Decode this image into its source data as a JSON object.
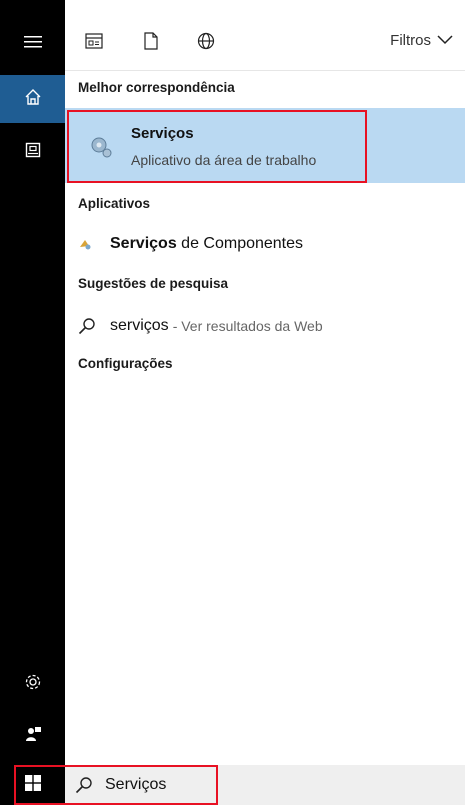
{
  "left_rail": {
    "items": [
      {
        "name": "menu-icon"
      },
      {
        "name": "home-icon"
      },
      {
        "name": "documents-icon"
      },
      {
        "name": "settings-icon"
      },
      {
        "name": "user-feedback-icon"
      }
    ]
  },
  "topbar": {
    "filters_label": "Filtros"
  },
  "sections": {
    "best_match_title": "Melhor correspondência",
    "apps_title": "Aplicativos",
    "suggestions_title": "Sugestões de pesquisa",
    "settings_title": "Configurações"
  },
  "best_match": {
    "name": "Serviços",
    "subtitle": "Aplicativo da área de trabalho"
  },
  "apps": [
    {
      "bold": "Serviços",
      "rest": " de Componentes"
    }
  ],
  "suggestions": [
    {
      "term": "serviços",
      "tail": "- Ver resultados da Web"
    }
  ],
  "search": {
    "value": "Serviços"
  },
  "colors": {
    "rail": "#000000",
    "active": "#1f5d93",
    "highlight": "#bad9f2",
    "red_frame": "#e81123"
  }
}
